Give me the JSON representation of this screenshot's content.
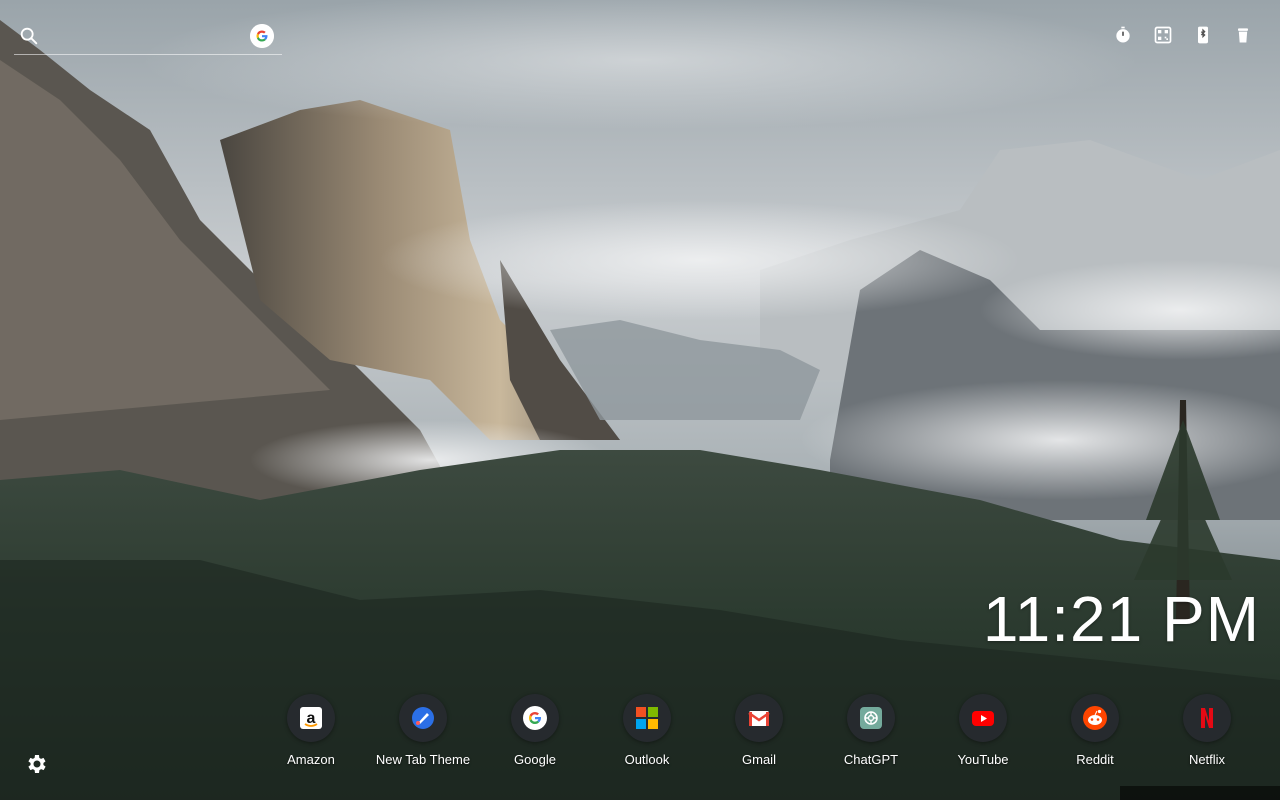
{
  "search": {
    "placeholder": "",
    "value": "",
    "engine_icon": "google-icon"
  },
  "toolbar": {
    "buttons": [
      {
        "name": "timer-icon"
      },
      {
        "name": "qr-icon"
      },
      {
        "name": "bluetooth-phone-icon"
      },
      {
        "name": "trash-icon"
      }
    ]
  },
  "clock": {
    "time": "11:21 PM"
  },
  "shortcuts": [
    {
      "label": "Amazon",
      "icon": "amazon-icon",
      "color": "#ffffff"
    },
    {
      "label": "New Tab Theme",
      "icon": "newtab-theme-icon",
      "color": "#2b6fe6"
    },
    {
      "label": "Google",
      "icon": "google-icon",
      "color": "#4285f4"
    },
    {
      "label": "Outlook",
      "icon": "microsoft-icon",
      "color": "#f25022"
    },
    {
      "label": "Gmail",
      "icon": "gmail-icon",
      "color": "#ea4335"
    },
    {
      "label": "ChatGPT",
      "icon": "chatgpt-icon",
      "color": "#74aa9c"
    },
    {
      "label": "YouTube",
      "icon": "youtube-icon",
      "color": "#ff0000"
    },
    {
      "label": "Reddit",
      "icon": "reddit-icon",
      "color": "#ff4500"
    },
    {
      "label": "Netflix",
      "icon": "netflix-icon",
      "color": "#e50914"
    }
  ],
  "settings": {
    "icon": "gear-icon"
  }
}
